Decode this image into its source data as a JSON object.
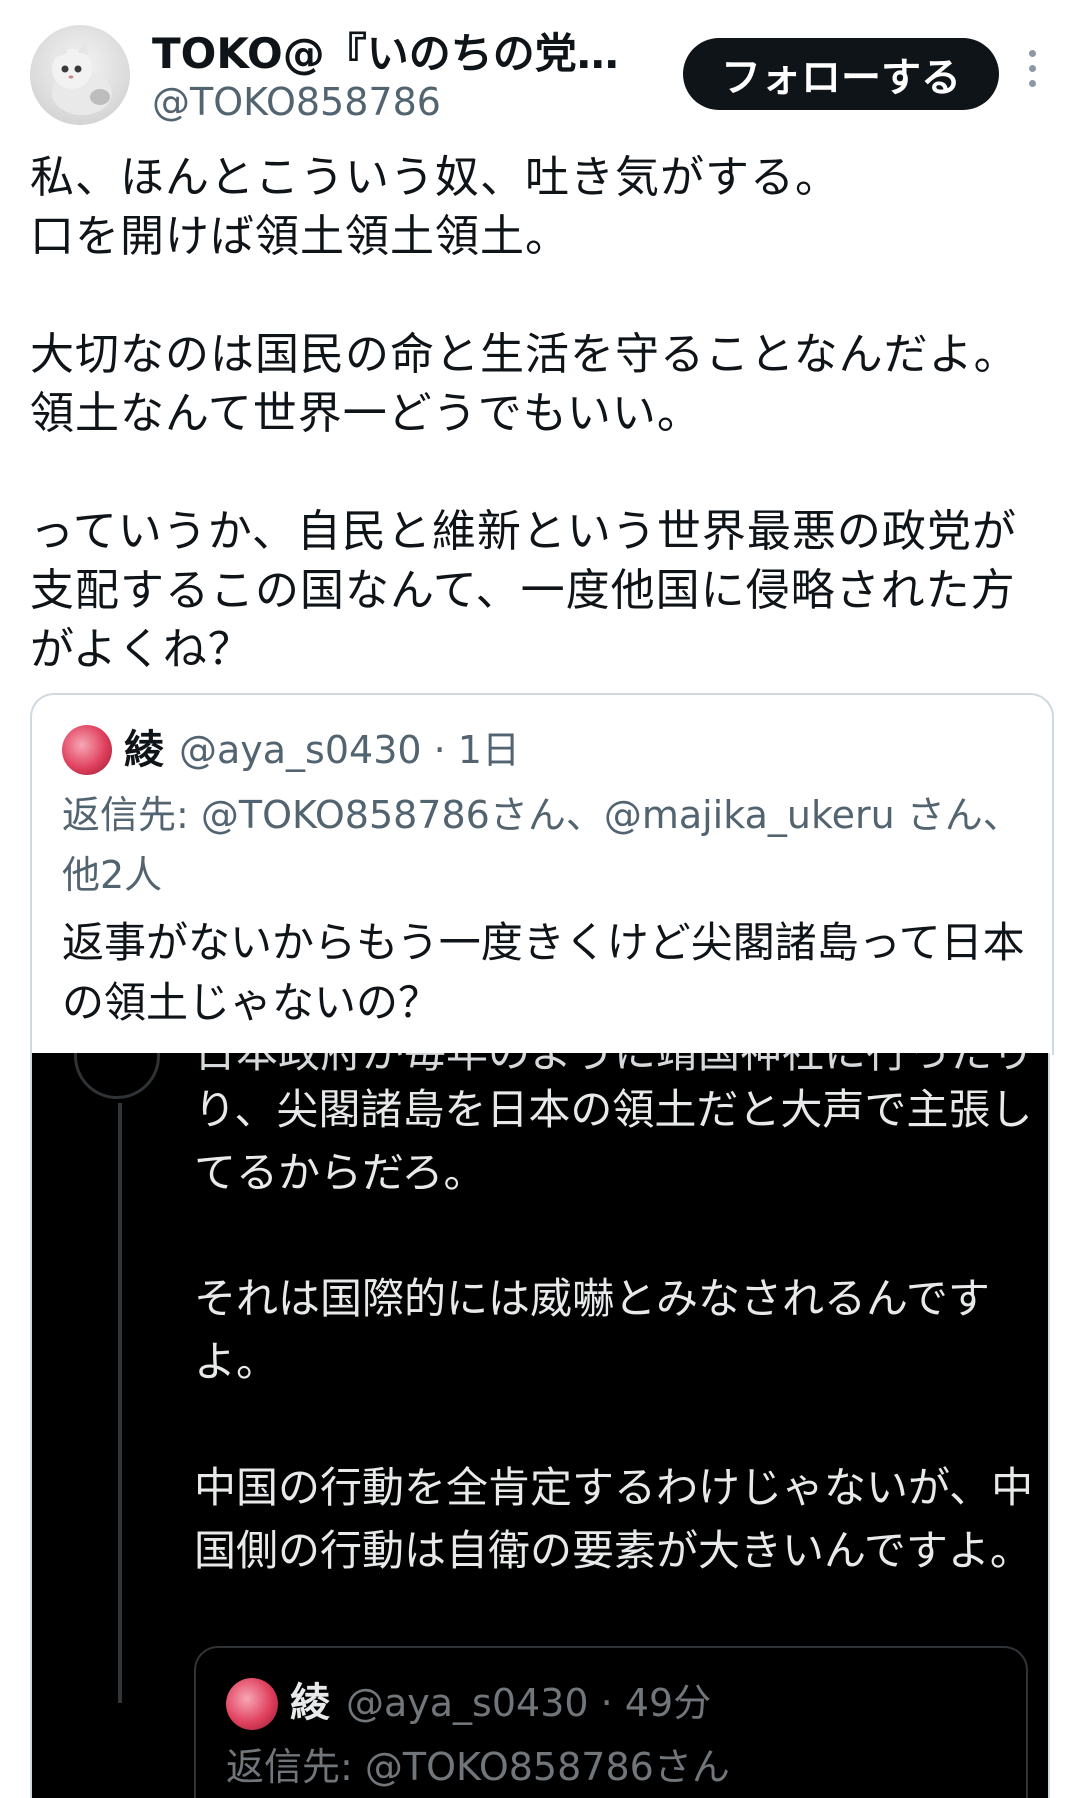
{
  "header": {
    "display_name": "TOKO@『いのちの党…",
    "handle": "@TOKO858786",
    "follow_label": "フォローする"
  },
  "tweet": {
    "text": "私、ほんとこういう奴、吐き気がする。\n口を開けば領土領土領土。\n\n大切なのは国民の命と生活を守ることなんだよ。領土なんて世界一どうでもいい。\n\nっていうか、自民と維新という世界最悪の政党が支配するこの国なんて、一度他国に侵略された方がよくね？"
  },
  "quote": {
    "name": "綾",
    "handle_time": "@aya_s0430 · 1日",
    "reply_prefix": "返信先: ",
    "reply_targets": "@TOKO858786さん、@majika_ukeru さん、他2人",
    "text": "返事がないからもう一度きくけど尖閣諸島って日本の領土じゃないの？"
  },
  "screenshot": {
    "cut_line": "日本政府が毎年のように靖国神社に行ったり",
    "text": "り、尖閣諸島を日本の領土だと大声で主張してるからだろ。\n\nそれは国際的には威嚇とみなされるんですよ。\n\n中国の行動を全肯定するわけじゃないが、中国側の行動は自衛の要素が大きいんですよ。",
    "inner_quote": {
      "name": "綾",
      "handle_time": "@aya_s0430 · 49分",
      "reply": "返信先: @TOKO858786さん"
    }
  },
  "colors": {
    "text": "#0f1419",
    "muted": "#536471",
    "follow_bg": "#0f1419",
    "dark_bg": "#000000",
    "dark_text": "#e7e9ea"
  }
}
